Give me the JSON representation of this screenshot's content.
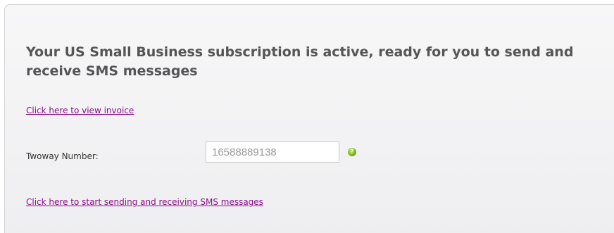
{
  "main": {
    "heading": "Your US Small Business subscription is active, ready for you to send and receive SMS messages",
    "invoice_link": "Click here to view invoice",
    "twoway_number": {
      "label": "Twoway Number:",
      "value": "16588889138",
      "help_icon": "question-icon",
      "help_icon_glyph": "?",
      "help_icon_color": "#7ab51d"
    },
    "start_link": "Click here to start sending and receiving SMS messages"
  },
  "colors": {
    "heading": "#555555",
    "link": "#8b0d8b",
    "panel_background": "#f0f0f2",
    "panel_border": "#d3d3d3"
  }
}
